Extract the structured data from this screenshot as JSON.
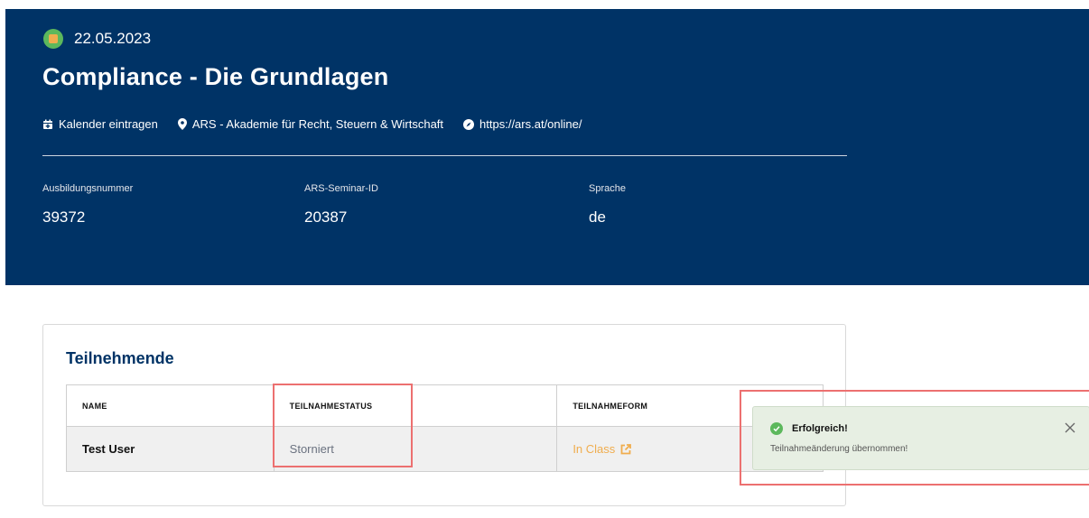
{
  "header": {
    "date": "22.05.2023",
    "title": "Compliance - Die Grundlagen",
    "meta": {
      "calendar_label": "Kalender eintragen",
      "location_label": "ARS - Akademie für Recht, Steuern & Wirtschaft",
      "url_label": "https://ars.at/online/"
    },
    "fields": [
      {
        "label": "Ausbildungsnummer",
        "value": "39372"
      },
      {
        "label": "ARS-Seminar-ID",
        "value": "20387"
      },
      {
        "label": "Sprache",
        "value": "de"
      }
    ]
  },
  "participants": {
    "title": "Teilnehmende",
    "columns": [
      "NAME",
      "TEILNAHMESTATUS",
      "TEILNAHMEFORM"
    ],
    "rows": [
      {
        "name": "Test User",
        "status": "Storniert",
        "form": "In Class"
      }
    ]
  },
  "toast": {
    "title": "Erfolgreich!",
    "message": "Teilnahmeänderung übernommen!"
  },
  "colors": {
    "hero_bg": "#003366",
    "accent_orange": "#f0ad4e",
    "success_green": "#5cb85c",
    "highlight_red": "#ec7070"
  },
  "icons": {
    "calendar": "calendar-plus-icon",
    "location": "map-pin-icon",
    "url": "compass-icon",
    "external": "external-link-icon",
    "close": "close-icon",
    "success": "check-circle-icon"
  }
}
